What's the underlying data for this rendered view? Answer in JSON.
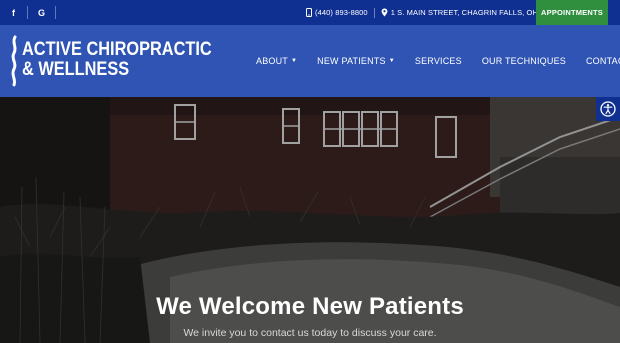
{
  "topbar": {
    "social": [
      {
        "name": "facebook",
        "glyph": "f"
      },
      {
        "name": "google",
        "glyph": "G"
      }
    ],
    "phone": "(440) 893-8800",
    "address": "1 S. MAIN STREET, CHAGRIN FALLS, OH",
    "appointments_label": "APPOINTMENTS"
  },
  "logo": {
    "line1": "ACTIVE CHIROPRACTIC",
    "line2": "& WELLNESS"
  },
  "nav": {
    "items": [
      {
        "label": "ABOUT",
        "dropdown": true
      },
      {
        "label": "NEW PATIENTS",
        "dropdown": true
      },
      {
        "label": "SERVICES",
        "dropdown": false
      },
      {
        "label": "OUR TECHNIQUES",
        "dropdown": false
      },
      {
        "label": "CONTACT",
        "dropdown": false
      }
    ]
  },
  "hero": {
    "title": "We Welcome New Patients",
    "subtitle": "We invite you to contact us today to discuss your care."
  },
  "colors": {
    "topbar": "#0f2f91",
    "header": "#2f54b3",
    "appointments": "#2f8f3f"
  }
}
